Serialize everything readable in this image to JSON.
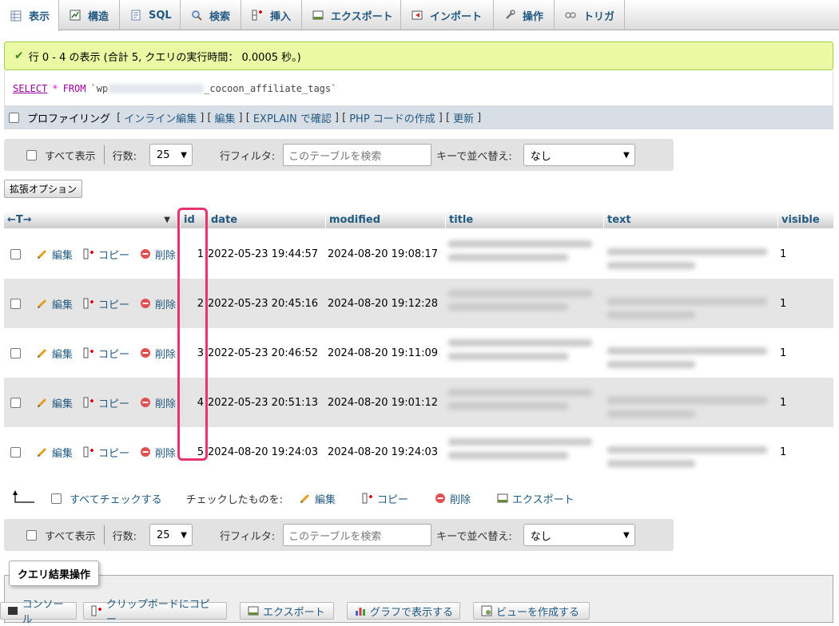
{
  "tabs": [
    {
      "label": "表示",
      "icon": "table-icon",
      "active": true
    },
    {
      "label": "構造",
      "icon": "structure-icon"
    },
    {
      "label": "SQL",
      "icon": "sql-icon"
    },
    {
      "label": "検索",
      "icon": "search-icon"
    },
    {
      "label": "挿入",
      "icon": "insert-icon"
    },
    {
      "label": "エクスポート",
      "icon": "export-icon"
    },
    {
      "label": "インポート",
      "icon": "import-icon"
    },
    {
      "label": "操作",
      "icon": "wrench-icon"
    },
    {
      "label": "トリガ",
      "icon": "trigger-icon"
    }
  ],
  "message": {
    "text": "行 0 - 4 の表示 (合計 5, クエリの実行時間： 0.0005 秒。)",
    "color": "#ebf8a4"
  },
  "sql": {
    "select": "SELECT",
    "star": "*",
    "from": "FROM",
    "table_prefix": "`wp",
    "table_suffix": "_cocoon_affiliate_tags`"
  },
  "profiling": {
    "label": "プロファイリング",
    "links": [
      "インライン編集",
      "編集",
      "EXPLAIN で確認",
      "PHP コードの作成",
      "更新"
    ]
  },
  "navbar": {
    "show_all": "すべて表示",
    "rows_label": "行数:",
    "rows_value": "25",
    "filter_label": "行フィルタ:",
    "filter_placeholder": "このテーブルを検索",
    "sort_label": "キーで並べ替え:",
    "sort_value": "なし"
  },
  "extended_options": "拡張オプション",
  "table": {
    "arrows": "←T→",
    "columns": [
      "id",
      "date",
      "modified",
      "title",
      "text",
      "visible"
    ],
    "actions": {
      "edit": "編集",
      "copy": "コピー",
      "delete": "削除"
    },
    "rows": [
      {
        "id": "1",
        "date": "2022-05-23 19:44:57",
        "modified": "2024-08-20 19:08:17",
        "visible": "1"
      },
      {
        "id": "2",
        "date": "2022-05-23 20:45:16",
        "modified": "2024-08-20 19:12:28",
        "visible": "1"
      },
      {
        "id": "3",
        "date": "2022-05-23 20:46:52",
        "modified": "2024-08-20 19:11:09",
        "visible": "1"
      },
      {
        "id": "4",
        "date": "2022-05-23 20:51:13",
        "modified": "2024-08-20 19:01:12",
        "visible": "1"
      },
      {
        "id": "5",
        "date": "2024-08-20 19:24:03",
        "modified": "2024-08-20 19:24:03",
        "visible": "1"
      }
    ],
    "highlight_color": "#e6336e"
  },
  "with_selected": {
    "check_all": "すべてチェックする",
    "label": "チェックしたものを:",
    "edit": "編集",
    "copy": "コピー",
    "delete": "削除",
    "export": "エクスポート"
  },
  "query_ops": {
    "legend": "クエリ結果操作",
    "buttons": [
      "コンソール",
      "クリップボードにコピー",
      "エクスポート",
      "グラフで表示する",
      "ビューを作成する"
    ]
  }
}
